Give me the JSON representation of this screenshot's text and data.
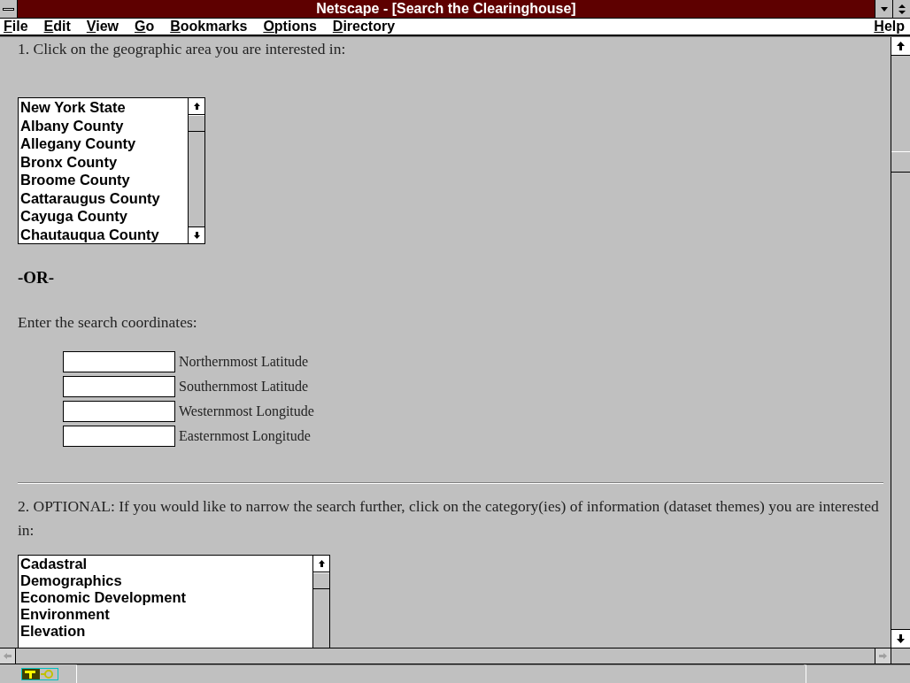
{
  "window": {
    "title": "Netscape - [Search the Clearinghouse]"
  },
  "menu": [
    {
      "label": "File"
    },
    {
      "label": "Edit"
    },
    {
      "label": "View"
    },
    {
      "label": "Go"
    },
    {
      "label": "Bookmarks"
    },
    {
      "label": "Options"
    },
    {
      "label": "Directory"
    }
  ],
  "help_menu": {
    "label": "Help"
  },
  "step1": "1. Click on the geographic area you are interested in:",
  "regions": [
    {
      "label": "New York State",
      "selected": false
    },
    {
      "label": "Albany County",
      "selected": false
    },
    {
      "label": "Allegany County",
      "selected": false
    },
    {
      "label": "Bronx County",
      "selected": false
    },
    {
      "label": "Broome County",
      "selected": false
    },
    {
      "label": "Cattaraugus County",
      "selected": false
    },
    {
      "label": "Cayuga County",
      "selected": false
    },
    {
      "label": "Chautauqua County",
      "selected": false
    }
  ],
  "or_label": "-OR-",
  "coords_prompt": "Enter the search coordinates:",
  "coordinate_fields": [
    {
      "label": "Northernmost Latitude"
    },
    {
      "label": "Southernmost Latitude"
    },
    {
      "label": "Westernmost Longitude"
    },
    {
      "label": "Easternmost Longitude"
    }
  ],
  "step2": "2. OPTIONAL: If you would like to narrow the search further, click on the category(ies) of information (dataset themes) you are interested in:",
  "themes": [
    {
      "label": "Cadastral",
      "selected": false
    },
    {
      "label": "Demographics",
      "selected": false
    },
    {
      "label": "Economic Development",
      "selected": false
    },
    {
      "label": "Environment",
      "selected": false
    },
    {
      "label": "Elevation",
      "selected": false
    }
  ]
}
